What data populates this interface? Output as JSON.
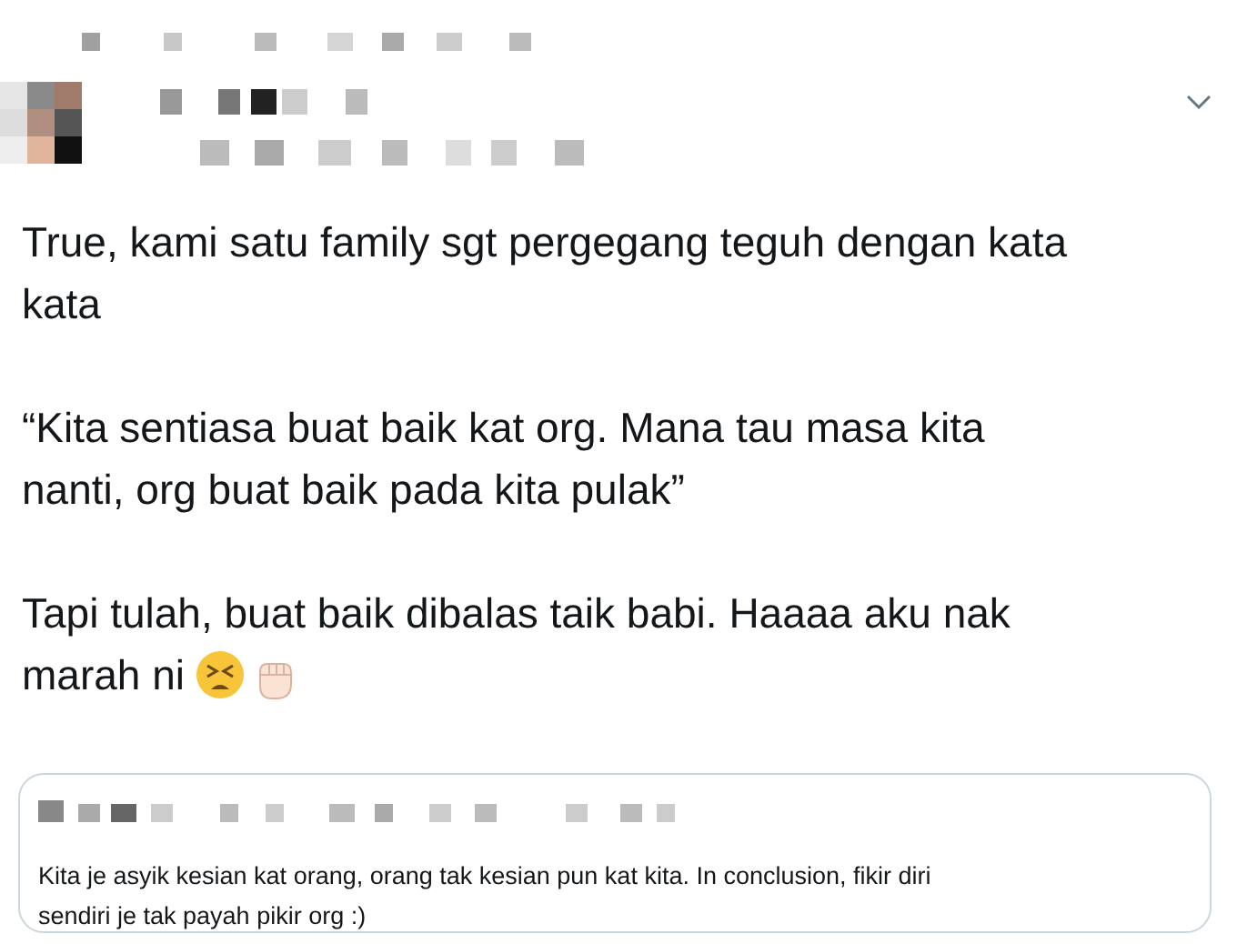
{
  "tweet": {
    "paragraphs": [
      {
        "lines": [
          "True, kami satu family sgt pergegang teguh dengan kata",
          "kata"
        ]
      },
      {
        "lines": [
          "“Kita sentiasa buat baik kat org. Mana tau masa kita",
          "nanti, org buat baik pada kita pulak”"
        ]
      },
      {
        "lines": [
          "Tapi tulah, buat baik dibalas taik babi. Haaaa aku nak",
          "marah ni"
        ]
      }
    ]
  },
  "quoted_tweet": {
    "lines": [
      "Kita je asyik kesian kat orang, orang tak kesian pun kat kita. In conclusion, fikir diri",
      "sendiri je tak payah pikir org :)"
    ]
  }
}
